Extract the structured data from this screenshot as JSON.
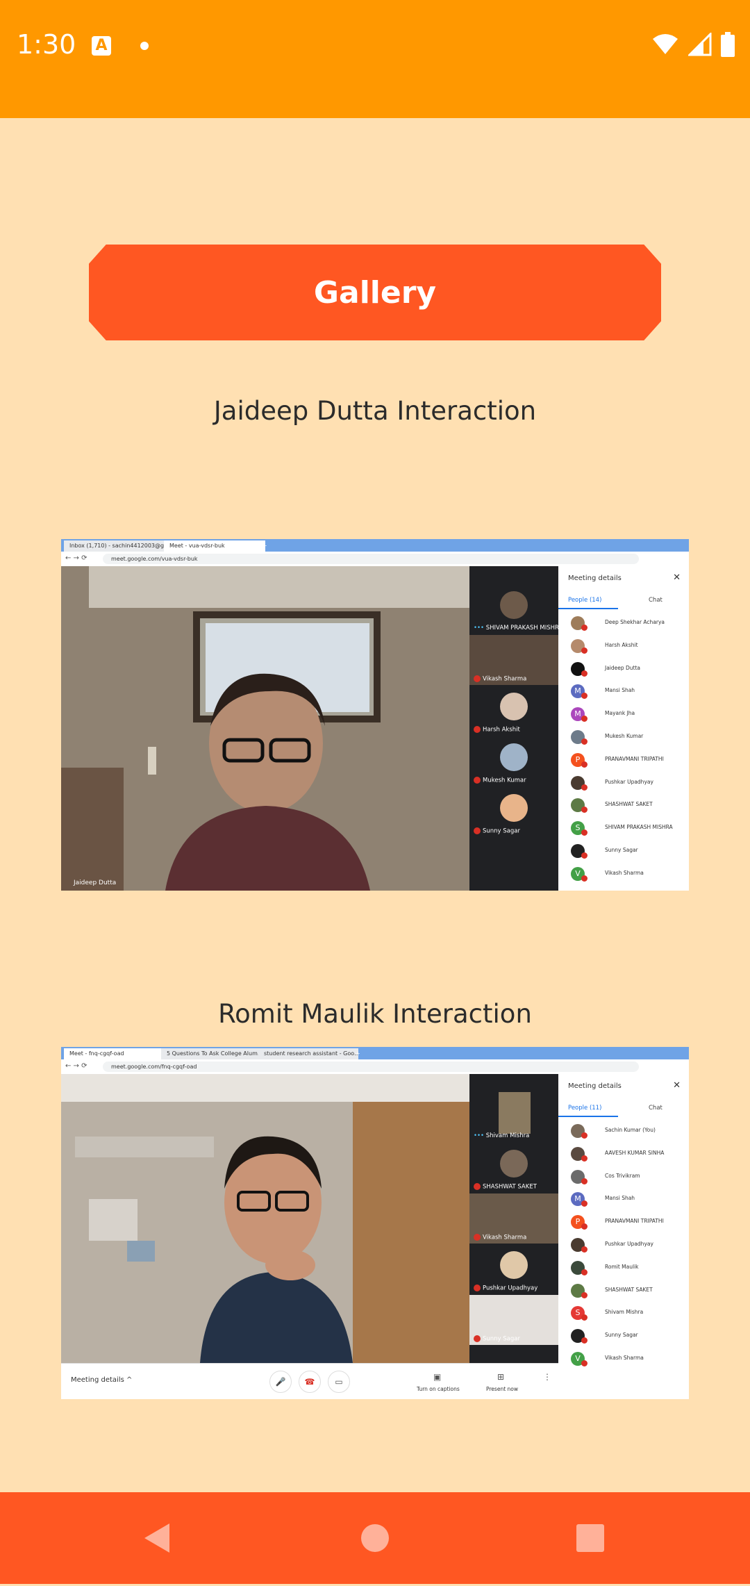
{
  "status_bar": {
    "time": "1:30",
    "a_badge": "A"
  },
  "gallery_button": "Gallery",
  "sections": [
    {
      "caption": "Jaideep Dutta Interaction",
      "browser": {
        "tabs": [
          "Inbox (1,710) - sachin4412003@g…",
          "Meet - vua-vdsr-buk",
          "+"
        ],
        "url": "meet.google.com/vua-vdsr-buk"
      },
      "main_speaker": "Jaideep Dutta",
      "tiles": [
        "SHIVAM PRAKASH MISHRA",
        "Vikash Sharma",
        "Harsh Akshit",
        "Mukesh Kumar",
        "Sunny Sagar"
      ],
      "panel": {
        "title": "Meeting details",
        "people_tab": "People (14)",
        "chat_tab": "Chat",
        "people": [
          {
            "name": "Deep Shekhar Acharya",
            "initial": "",
            "color": "#9e7c5a"
          },
          {
            "name": "Harsh Akshit",
            "initial": "",
            "color": "#b58a6b"
          },
          {
            "name": "Jaideep Dutta",
            "initial": "",
            "color": "#111111"
          },
          {
            "name": "Mansi Shah",
            "initial": "M",
            "color": "#5c6bc0"
          },
          {
            "name": "Mayank Jha",
            "initial": "M",
            "color": "#ab47bc"
          },
          {
            "name": "Mukesh Kumar",
            "initial": "",
            "color": "#6d7b8a"
          },
          {
            "name": "PRANAVMANI TRIPATHI",
            "initial": "P",
            "color": "#f4511e"
          },
          {
            "name": "Pushkar Upadhyay",
            "initial": "",
            "color": "#4a3b30"
          },
          {
            "name": "SHASHWAT SAKET",
            "initial": "",
            "color": "#5d7a45"
          },
          {
            "name": "SHIVAM PRAKASH MISHRA",
            "initial": "S",
            "color": "#43a047"
          },
          {
            "name": "Sunny Sagar",
            "initial": "",
            "color": "#222222"
          },
          {
            "name": "Vikash Sharma",
            "initial": "V",
            "color": "#43a047"
          }
        ]
      }
    },
    {
      "caption": "Romit Maulik Interaction",
      "browser": {
        "tabs": [
          "Meet - fnq-cgqf-oad",
          "5 Questions To Ask College Alum…",
          "student research assistant - Goo…",
          "+"
        ],
        "url": "meet.google.com/fnq-cgqf-oad"
      },
      "tiles": [
        "Shivam Mishra",
        "SHASHWAT SAKET",
        "Vikash Sharma",
        "Pushkar Upadhyay",
        "Sunny Sagar"
      ],
      "panel": {
        "title": "Meeting details",
        "people_tab": "People (11)",
        "chat_tab": "Chat",
        "people": [
          {
            "name": "Sachin Kumar (You)",
            "initial": "",
            "color": "#7a6a5a"
          },
          {
            "name": "AAVESH KUMAR SINHA",
            "initial": "",
            "color": "#5a4a40"
          },
          {
            "name": "Cos Trivikram",
            "initial": "",
            "color": "#6b6b6b"
          },
          {
            "name": "Mansi Shah",
            "initial": "M",
            "color": "#5c6bc0"
          },
          {
            "name": "PRANAVMANI TRIPATHI",
            "initial": "P",
            "color": "#f4511e"
          },
          {
            "name": "Pushkar Upadhyay",
            "initial": "",
            "color": "#4a3b30"
          },
          {
            "name": "Romit Maulik",
            "initial": "",
            "color": "#3b4a3b"
          },
          {
            "name": "SHASHWAT SAKET",
            "initial": "",
            "color": "#5d7a45"
          },
          {
            "name": "Shivam Mishra",
            "initial": "S",
            "color": "#e53935"
          },
          {
            "name": "Sunny Sagar",
            "initial": "",
            "color": "#222222"
          },
          {
            "name": "Vikash Sharma",
            "initial": "V",
            "color": "#43a047"
          }
        ]
      },
      "bottom_bar": {
        "meeting_details": "Meeting details ^",
        "captions": "Turn on captions",
        "present": "Present now"
      }
    }
  ],
  "colors": {
    "status_bar": "#FF9800",
    "background": "#FFE0B2",
    "accent": "#FF5722"
  }
}
